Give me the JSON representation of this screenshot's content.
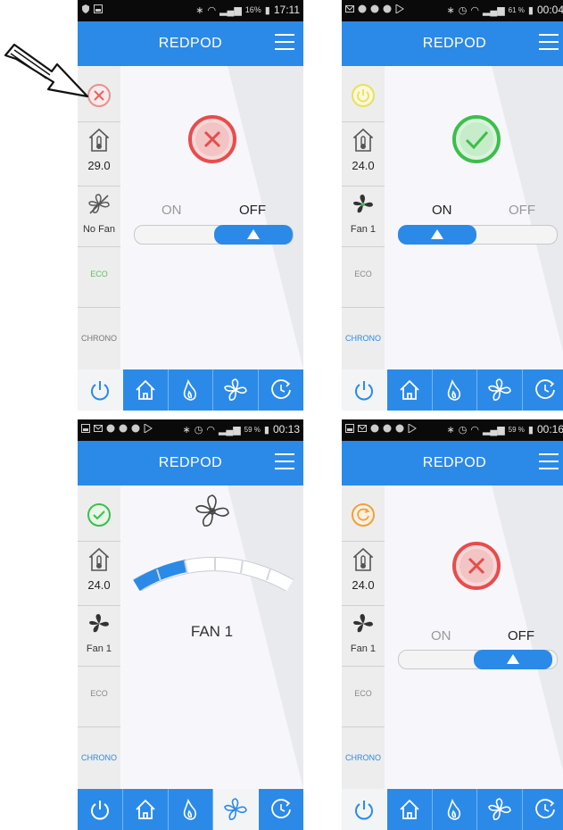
{
  "colors": {
    "accent": "#2b8ae8",
    "red": "#e84c4c",
    "green": "#3cbf4b",
    "yellow": "#e8e060",
    "orange": "#f0a040",
    "eco_green": "#5fbf5f"
  },
  "common": {
    "app_title": "REDPOD",
    "temp_value": "24.0",
    "eco_label": "ECO",
    "chrono_label": "CHRONO",
    "on_label": "ON",
    "off_label": "OFF"
  },
  "annotation": {
    "icon": "arrow-icon"
  },
  "screens": [
    {
      "time": "17:11",
      "battery": "16%",
      "temp_value": "29.0",
      "fan_label": "No Fan",
      "status_icon": "x-circle-icon",
      "toggle": "OFF"
    },
    {
      "time": "00:04",
      "battery": "61 %",
      "temp_value": "24.0",
      "fan_label": "Fan 1",
      "status_icon": "check-circle-icon",
      "toggle": "ON"
    },
    {
      "time": "00:13",
      "battery": "59 %",
      "temp_value": "24.0",
      "fan_label": "Fan 1",
      "status_icon": "check-circle-icon",
      "fan_speed_label": "FAN 1",
      "fan_level": 2,
      "fan_levels_total": 6
    },
    {
      "time": "00:16",
      "battery": "59 %",
      "temp_value": "24.0",
      "fan_label": "Fan 1",
      "status_icon": "refresh-circle-icon",
      "toggle": "OFF"
    }
  ]
}
